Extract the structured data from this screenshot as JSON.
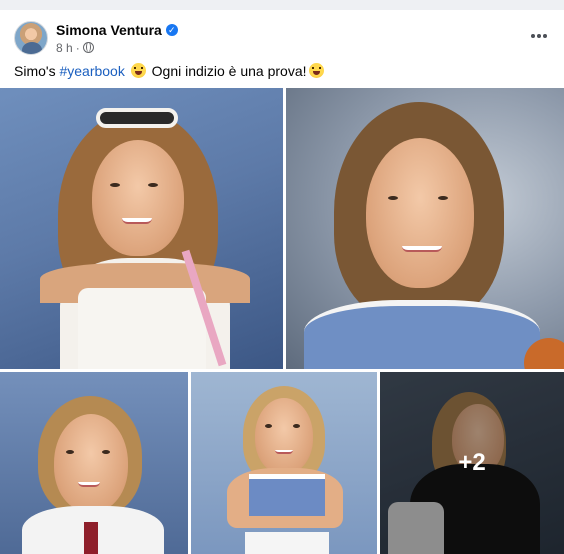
{
  "post": {
    "author": "Simona Ventura",
    "time": "8 h",
    "dot": "·",
    "caption_prefix": "Simo's ",
    "hashtag": "#yearbook",
    "caption_mid": " Ogni indizio è una prova!",
    "more_photos": "+2",
    "verified_glyph": "✓"
  },
  "icons": {
    "verified": "verified-badge-icon",
    "audience": "globe-icon",
    "options": "more-options-icon",
    "emoji_1": "grinning-face-emoji",
    "emoji_2": "winking-tongue-face-emoji"
  },
  "colors": {
    "accent": "#1877f2",
    "hashtag": "#1b5fbf",
    "secondary_text": "#65676b"
  }
}
